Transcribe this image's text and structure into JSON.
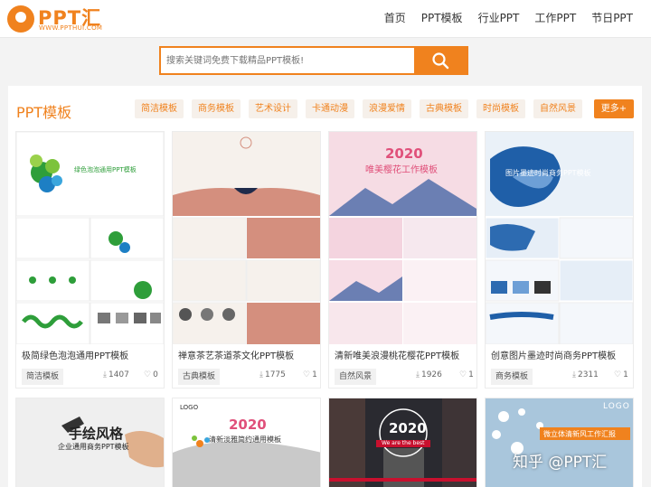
{
  "header": {
    "logo_text": "PPT汇",
    "logo_url": "WWW.PPTHUI.COM",
    "nav": [
      "首页",
      "PPT模板",
      "行业PPT",
      "工作PPT",
      "节日PPT"
    ]
  },
  "search": {
    "placeholder": "搜索关键词免费下载精品PPT模板!"
  },
  "section": {
    "title": "PPT模板",
    "categories": [
      "简洁模板",
      "商务模板",
      "艺术设计",
      "卡通动漫",
      "浪漫爱情",
      "古典模板",
      "时尚模板",
      "自然风景"
    ],
    "more": "更多+"
  },
  "cards": [
    {
      "title": "极简绿色泡泡通用PPT模板",
      "tag": "简洁模板",
      "downloads": "1407",
      "likes": "0",
      "thumb_text": "绿色泡泡通用PPT模板"
    },
    {
      "title": "禅意茶艺茶道茶文化PPT模板",
      "tag": "古典模板",
      "downloads": "1775",
      "likes": "1",
      "thumb_text": ""
    },
    {
      "title": "清新唯美浪漫桃花樱花PPT模板",
      "tag": "自然风景",
      "downloads": "1926",
      "likes": "1",
      "thumb_text": "唯美樱花工作模板",
      "thumb_year": "2020"
    },
    {
      "title": "创意图片墨迹时尚商务PPT模板",
      "tag": "商务模板",
      "downloads": "2311",
      "likes": "1",
      "thumb_text": "图片墨迹时尚商务PPT模板"
    }
  ],
  "row2": [
    {
      "thumb_title": "手绘风格",
      "thumb_sub": "企业通用商务PPT模板"
    },
    {
      "thumb_logo": "LOGO",
      "thumb_year": "2020",
      "thumb_title": "清新淡雅简约通用模板"
    },
    {
      "thumb_year": "2020",
      "thumb_sub": "We are the best"
    },
    {
      "thumb_logo": "LOGO",
      "thumb_title": "微立体清新风工作汇报"
    }
  ],
  "watermark": "知乎 @PPT汇",
  "colors": {
    "accent": "#f0821e"
  }
}
